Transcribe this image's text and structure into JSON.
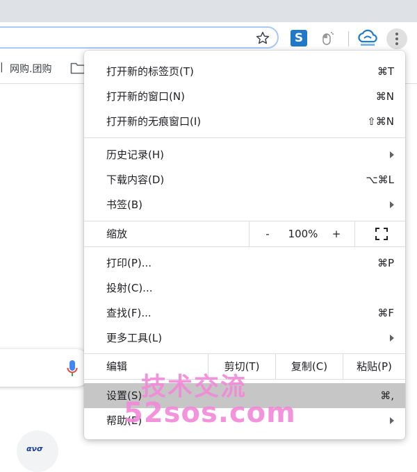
{
  "toolbar": {
    "bookmark_star": "star-icon",
    "extensions": [
      "s-extension-icon",
      "mouse-extension-icon",
      "cloud-extension-icon"
    ],
    "menu_button": "more-vert-icon"
  },
  "bookmarks": {
    "items": [
      {
        "label": "网购.团购"
      }
    ]
  },
  "menu": {
    "group1": [
      {
        "label": "打开新的标签页(T)",
        "shortcut": "⌘T"
      },
      {
        "label": "打开新的窗口(N)",
        "shortcut": "⌘N"
      },
      {
        "label": "打开新的无痕窗口(I)",
        "shortcut": "⇧⌘N"
      }
    ],
    "group2": [
      {
        "label": "历史记录(H)",
        "submenu": true
      },
      {
        "label": "下载内容(D)",
        "shortcut": "⌥⌘L"
      },
      {
        "label": "书签(B)",
        "submenu": true
      }
    ],
    "zoom": {
      "label": "缩放",
      "minus": "-",
      "value": "100%",
      "plus": "+"
    },
    "group3": [
      {
        "label": "打印(P)...",
        "shortcut": "⌘P"
      },
      {
        "label": "投射(C)...",
        "shortcut": ""
      },
      {
        "label": "查找(F)...",
        "shortcut": "⌘F"
      },
      {
        "label": "更多工具(L)",
        "submenu": true
      }
    ],
    "edit": {
      "label": "编辑",
      "cut": "剪切(T)",
      "copy": "复制(C)",
      "paste": "粘贴(P)"
    },
    "group4": [
      {
        "label": "设置(S)",
        "shortcut": "⌘,",
        "highlighted": true
      },
      {
        "label": "帮助(E)",
        "submenu": true
      }
    ]
  },
  "watermark": {
    "line1": "技术交流",
    "line2": "52sos.com"
  },
  "page": {
    "logo_text": "ανσ"
  },
  "colors": {
    "accent_focus": "#a8c7fa",
    "highlight": "#c6c6c6",
    "watermark": "#f28ad8"
  }
}
